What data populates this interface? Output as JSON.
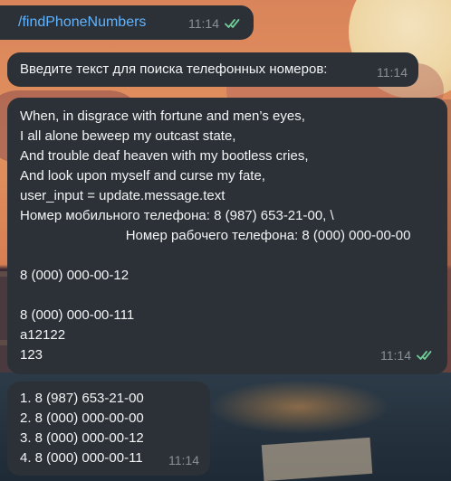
{
  "messages": [
    {
      "id": "cmd",
      "direction": "outgoing",
      "text": "/findPhoneNumbers",
      "time": "11:14",
      "status": "read",
      "status_icon": "double-check-icon"
    },
    {
      "id": "prompt",
      "direction": "incoming",
      "text": "Введите текст для поиска телефонных номеров:",
      "time": "11:14"
    },
    {
      "id": "input",
      "direction": "outgoing",
      "lines": [
        "When, in disgrace with fortune and men’s eyes,",
        "I all alone beweep my outcast state,",
        "And trouble deaf heaven with my bootless cries,",
        "And look upon myself and curse my fate,",
        "user_input = update.message.text",
        "Номер мобильного телефона: 8 (987) 653-21-00, \\",
        "                            Номер рабочего телефона: 8 (000) 000-00-00",
        "",
        "8 (000) 000-00-12",
        "",
        "8 (000) 000-00-111",
        "a12122",
        "123"
      ],
      "time": "11:14",
      "status": "read",
      "status_icon": "double-check-icon"
    },
    {
      "id": "result",
      "direction": "incoming",
      "lines": [
        "1. 8 (987) 653-21-00",
        "2. 8 (000) 000-00-00",
        "3. 8 (000) 000-00-12",
        "4. 8 (000) 000-00-11"
      ],
      "time": "11:14"
    }
  ],
  "colors": {
    "bubble": "#2c3137",
    "text": "#f2f4f5",
    "command": "#5fb3ff",
    "time": "#8a9096",
    "read_check": "#6fcf97"
  }
}
